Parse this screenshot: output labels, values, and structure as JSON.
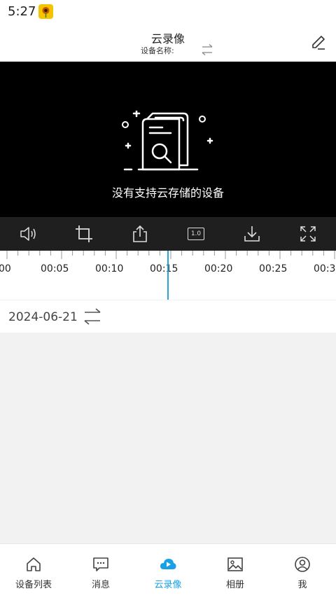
{
  "status_bar": {
    "time": "5:27"
  },
  "header": {
    "title": "云录像",
    "subtitle": "设备名称:"
  },
  "video": {
    "empty_message": "没有支持云存储的设备"
  },
  "toolbar": {
    "speed_label": "1.0",
    "icons": [
      "volume-icon",
      "crop-icon",
      "share-icon",
      "speed-icon",
      "download-icon",
      "fullscreen-icon"
    ]
  },
  "timeline": {
    "labels": [
      "00",
      "00:05",
      "00:10",
      "00:15",
      "00:20",
      "00:25",
      "00:30"
    ]
  },
  "date_row": {
    "date": "2024-06-21"
  },
  "colors": {
    "accent": "#1aa0e6",
    "playhead": "#29a3e0",
    "video_bg": "#000000",
    "toolbar_bg": "#1f1f1f"
  },
  "bottom_nav": {
    "items": [
      {
        "label": "设备列表",
        "icon": "home-icon",
        "active": false
      },
      {
        "label": "消息",
        "icon": "message-icon",
        "active": false
      },
      {
        "label": "云录像",
        "icon": "cloud-play-icon",
        "active": true
      },
      {
        "label": "相册",
        "icon": "album-icon",
        "active": false
      },
      {
        "label": "我",
        "icon": "profile-icon",
        "active": false
      }
    ]
  }
}
